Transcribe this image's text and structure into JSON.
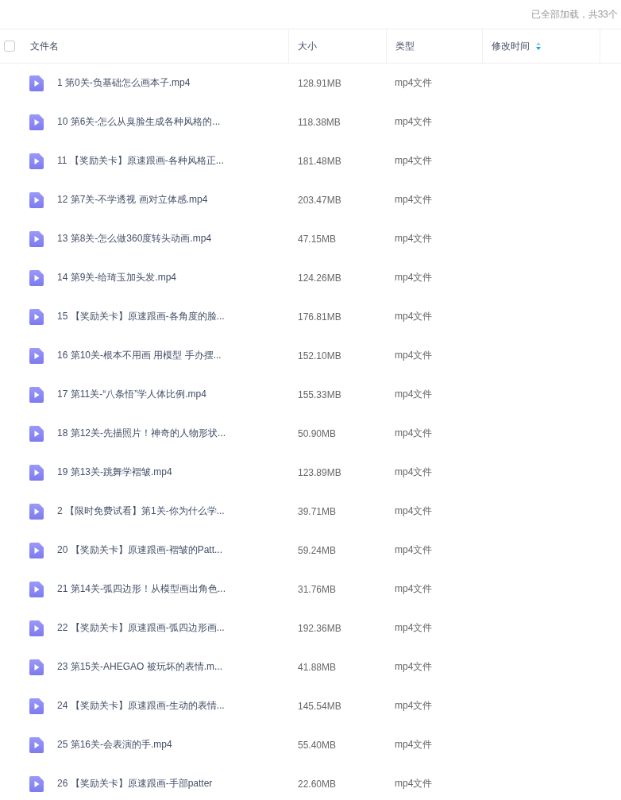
{
  "status": "已全部加载，共33个",
  "header": {
    "checked": false,
    "columns": [
      {
        "label": "文件名",
        "sorted": false
      },
      {
        "label": "大小",
        "sorted": false
      },
      {
        "label": "类型",
        "sorted": false
      },
      {
        "label": "修改时间",
        "sorted": true
      }
    ]
  },
  "rows": [
    {
      "name": "1 第0关-负基础怎么画本子.mp4",
      "size": "128.91MB",
      "type": "mp4文件"
    },
    {
      "name": "10 第6关-怎么从臭脸生成各种风格的...",
      "size": "118.38MB",
      "type": "mp4文件"
    },
    {
      "name": "11 【奖励关卡】原速跟画-各种风格正...",
      "size": "181.48MB",
      "type": "mp4文件"
    },
    {
      "name": "12 第7关-不学透视 画对立体感.mp4",
      "size": "203.47MB",
      "type": "mp4文件"
    },
    {
      "name": "13 第8关-怎么做360度转头动画.mp4",
      "size": "47.15MB",
      "type": "mp4文件"
    },
    {
      "name": "14 第9关-给琦玉加头发.mp4",
      "size": "124.26MB",
      "type": "mp4文件"
    },
    {
      "name": "15 【奖励关卡】原速跟画-各角度的脸...",
      "size": "176.81MB",
      "type": "mp4文件"
    },
    {
      "name": "16 第10关-根本不用画 用模型 手办摆...",
      "size": "152.10MB",
      "type": "mp4文件"
    },
    {
      "name": "17 第11关-“八条悟”学人体比例.mp4",
      "size": "155.33MB",
      "type": "mp4文件"
    },
    {
      "name": "18 第12关-先描照片！神奇的人物形状...",
      "size": "50.90MB",
      "type": "mp4文件"
    },
    {
      "name": "19 第13关-跳舞学褶皱.mp4",
      "size": "123.89MB",
      "type": "mp4文件"
    },
    {
      "name": "2 【限时免费试看】第1关-你为什么学...",
      "size": "39.71MB",
      "type": "mp4文件"
    },
    {
      "name": "20 【奖励关卡】原速跟画-褶皱的Patt...",
      "size": "59.24MB",
      "type": "mp4文件"
    },
    {
      "name": "21 第14关-弧四边形！从模型画出角色...",
      "size": "31.76MB",
      "type": "mp4文件"
    },
    {
      "name": "22 【奖励关卡】原速跟画-弧四边形画...",
      "size": "192.36MB",
      "type": "mp4文件"
    },
    {
      "name": "23 第15关-AHEGAO 被玩坏的表情.m...",
      "size": "41.88MB",
      "type": "mp4文件"
    },
    {
      "name": "24 【奖励关卡】原速跟画-生动的表情...",
      "size": "145.54MB",
      "type": "mp4文件"
    },
    {
      "name": "25 第16关-会表演的手.mp4",
      "size": "55.40MB",
      "type": "mp4文件"
    },
    {
      "name": "26 【奖励关卡】原速跟画-手部patter",
      "size": "22.60MB",
      "type": "mp4文件"
    }
  ]
}
